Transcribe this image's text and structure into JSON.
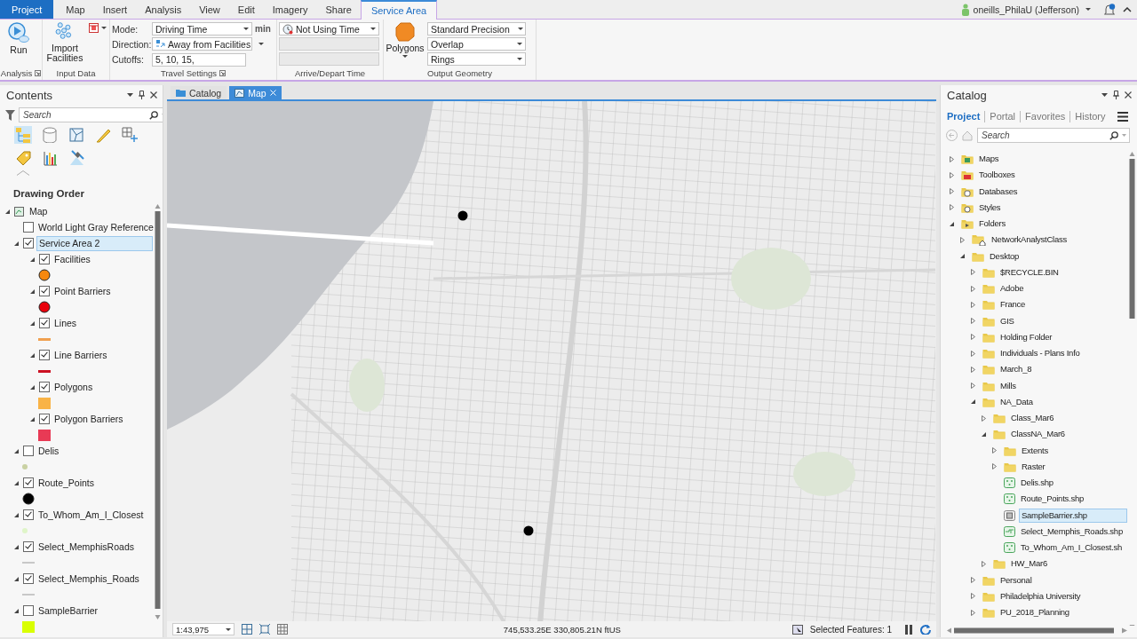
{
  "ribbon_tabs": [
    {
      "label": "Project",
      "kind": "backstage",
      "selected": false
    },
    {
      "label": "Map",
      "kind": "core",
      "selected": false
    },
    {
      "label": "Insert",
      "kind": "core",
      "selected": false
    },
    {
      "label": "Analysis",
      "kind": "core",
      "selected": false
    },
    {
      "label": "View",
      "kind": "core",
      "selected": false
    },
    {
      "label": "Edit",
      "kind": "core",
      "selected": false
    },
    {
      "label": "Imagery",
      "kind": "core",
      "selected": false
    },
    {
      "label": "Share",
      "kind": "core",
      "selected": false
    },
    {
      "label": "Service Area",
      "kind": "contextual",
      "selected": true
    }
  ],
  "account": {
    "user": "oneills_PhilaU (Jefferson)"
  },
  "ribbon": {
    "analysis": {
      "label": "Analysis",
      "launcher": true,
      "run_button": "Run"
    },
    "input_data": {
      "label": "Input Data",
      "import_button": "Import Facilities"
    },
    "travel_settings": {
      "label": "Travel Settings",
      "launcher": true,
      "fields": [
        {
          "label": "Mode:",
          "kind": "dropdown",
          "value": "Driving Time",
          "unit": "min"
        },
        {
          "label": "Direction:",
          "kind": "dropdown",
          "value": "Away from Facilities"
        },
        {
          "label": "Cutoffs:",
          "kind": "text",
          "value": "5, 10, 15,"
        }
      ]
    },
    "arrive_depart": {
      "label": "Arrive/Depart Time",
      "fields": [
        {
          "kind": "dropdown",
          "value": "Not Using Time",
          "disabled": false
        },
        {
          "kind": "text",
          "disabled": true
        },
        {
          "kind": "text",
          "disabled": true
        }
      ]
    },
    "output_geometry": {
      "label": "Output Geometry",
      "polygons_button": "Polygons",
      "dropdowns": [
        "Standard Precision",
        "Overlap",
        "Rings"
      ]
    }
  },
  "contents": {
    "title": "Contents",
    "search_placeholder": "Search",
    "heading": "Drawing Order",
    "layers": [
      {
        "name": "Map",
        "expanded": true,
        "selected": false,
        "children": [
          {
            "name": "World Light Gray Reference",
            "checked": false,
            "selected": false
          },
          {
            "name": "Service Area 2",
            "checked": true,
            "expanded": true,
            "selected": true,
            "children": [
              {
                "name": "Facilities",
                "checked": true,
                "expanded": true,
                "selected": false,
                "symbol": {
                  "kind": "circle",
                  "color": "#f7880f"
                }
              },
              {
                "name": "Point Barriers",
                "checked": true,
                "expanded": true,
                "selected": false,
                "symbol": {
                  "kind": "circle",
                  "color": "#e8000b"
                }
              },
              {
                "name": "Lines",
                "checked": true,
                "expanded": true,
                "selected": false,
                "symbol": {
                  "kind": "line",
                  "color": "#f0a050"
                }
              },
              {
                "name": "Line Barriers",
                "checked": true,
                "expanded": true,
                "selected": false,
                "symbol": {
                  "kind": "line",
                  "color": "#cc1122"
                }
              },
              {
                "name": "Polygons",
                "checked": true,
                "expanded": true,
                "selected": false,
                "symbol": {
                  "kind": "square",
                  "color": "#f9b347"
                }
              },
              {
                "name": "Polygon Barriers",
                "checked": true,
                "expanded": true,
                "selected": false,
                "symbol": {
                  "kind": "square",
                  "color": "#e83a55"
                }
              }
            ]
          },
          {
            "name": "Delis",
            "checked": false,
            "expanded": true,
            "selected": false,
            "symbol": {
              "kind": "dot",
              "color": "#c9d1a3"
            }
          },
          {
            "name": "Route_Points",
            "checked": true,
            "expanded": true,
            "selected": false,
            "symbol": {
              "kind": "circle",
              "color": "#000000"
            }
          },
          {
            "name": "To_Whom_Am_I_Closest",
            "checked": true,
            "expanded": true,
            "selected": false,
            "symbol": {
              "kind": "dot",
              "color": "#dff5c8"
            }
          },
          {
            "name": "Select_MemphisRoads",
            "checked": true,
            "expanded": true,
            "selected": false,
            "symbol": {
              "kind": "thin-line",
              "color": "#c8c8c8"
            }
          },
          {
            "name": "Select_Memphis_Roads",
            "checked": true,
            "expanded": true,
            "selected": false,
            "symbol": {
              "kind": "thin-line",
              "color": "#c8c8c8"
            }
          },
          {
            "name": "SampleBarrier",
            "checked": false,
            "expanded": true,
            "selected": false,
            "symbol": {
              "kind": "square",
              "color": "#d9ff00"
            }
          }
        ]
      }
    ]
  },
  "views": [
    {
      "label": "Catalog",
      "kind": "catalog",
      "selected": false
    },
    {
      "label": "Map",
      "kind": "map",
      "selected": true,
      "closable": true
    }
  ],
  "status_bar": {
    "scale": "1:43,975",
    "coordinates": "745,533.25E 330,805.21N ftUS",
    "selected_features": "Selected Features: 1"
  },
  "catalog": {
    "title": "Catalog",
    "tabs": [
      {
        "label": "Project",
        "selected": true
      },
      {
        "label": "Portal",
        "selected": false
      },
      {
        "label": "Favorites",
        "selected": false
      },
      {
        "label": "History",
        "selected": false
      }
    ],
    "search_placeholder": "Search",
    "items": [
      {
        "name": "Maps",
        "kind": "maps",
        "expanded": false,
        "selected": false
      },
      {
        "name": "Toolboxes",
        "kind": "toolboxes",
        "expanded": false,
        "selected": false
      },
      {
        "name": "Databases",
        "kind": "databases",
        "expanded": false,
        "selected": false
      },
      {
        "name": "Styles",
        "kind": "styles",
        "expanded": false,
        "selected": false
      },
      {
        "name": "Folders",
        "kind": "folders",
        "expanded": true,
        "selected": false,
        "children": [
          {
            "name": "NetworkAnalystClass",
            "kind": "folder-home",
            "expanded": false,
            "selected": false
          },
          {
            "name": "Desktop",
            "kind": "folder",
            "expanded": true,
            "selected": false,
            "children": [
              {
                "name": "$RECYCLE.BIN",
                "kind": "folder",
                "expanded": false,
                "selected": false
              },
              {
                "name": "Adobe",
                "kind": "folder",
                "expanded": false,
                "selected": false
              },
              {
                "name": "France",
                "kind": "folder",
                "expanded": false,
                "selected": false
              },
              {
                "name": "GIS",
                "kind": "folder",
                "expanded": false,
                "selected": false
              },
              {
                "name": "Holding Folder",
                "kind": "folder",
                "expanded": false,
                "selected": false
              },
              {
                "name": "Individuals - Plans Info",
                "kind": "folder",
                "expanded": false,
                "selected": false
              },
              {
                "name": "March_8",
                "kind": "folder",
                "expanded": false,
                "selected": false
              },
              {
                "name": "Mills",
                "kind": "folder",
                "expanded": false,
                "selected": false
              },
              {
                "name": "NA_Data",
                "kind": "folder",
                "expanded": true,
                "selected": false,
                "children": [
                  {
                    "name": "Class_Mar6",
                    "kind": "folder",
                    "expanded": false,
                    "selected": false
                  },
                  {
                    "name": "ClassNA_Mar6",
                    "kind": "folder",
                    "expanded": true,
                    "selected": false,
                    "children": [
                      {
                        "name": "Extents",
                        "kind": "folder",
                        "expanded": false,
                        "selected": false
                      },
                      {
                        "name": "Raster",
                        "kind": "folder",
                        "expanded": false,
                        "selected": false
                      },
                      {
                        "name": "Delis.shp",
                        "kind": "point-shapefile",
                        "selected": false
                      },
                      {
                        "name": "Route_Points.shp",
                        "kind": "point-shapefile",
                        "selected": false
                      },
                      {
                        "name": "SampleBarrier.shp",
                        "kind": "polygon-shapefile",
                        "selected": true
                      },
                      {
                        "name": "Select_Memphis_Roads.shp",
                        "kind": "line-shapefile",
                        "selected": false
                      },
                      {
                        "name": "To_Whom_Am_I_Closest.sh",
                        "kind": "point-shapefile",
                        "selected": false
                      }
                    ]
                  },
                  {
                    "name": "HW_Mar6",
                    "kind": "folder",
                    "expanded": false,
                    "selected": false
                  }
                ]
              },
              {
                "name": "Personal",
                "kind": "folder",
                "expanded": false,
                "selected": false
              },
              {
                "name": "Philadelphia University",
                "kind": "folder",
                "expanded": false,
                "selected": false
              },
              {
                "name": "PU_2018_Planning",
                "kind": "folder",
                "expanded": false,
                "selected": false
              }
            ]
          }
        ]
      }
    ]
  }
}
